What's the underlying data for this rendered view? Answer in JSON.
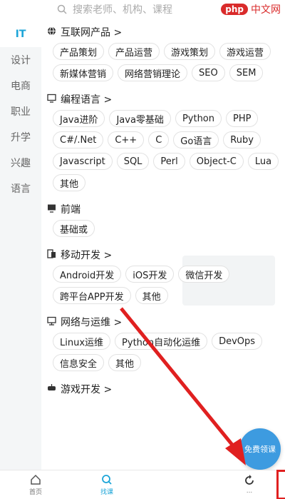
{
  "search": {
    "placeholder": "搜索老师、机构、课程"
  },
  "watermark": {
    "php": "php",
    "text": "中文网"
  },
  "sidebar": {
    "items": [
      {
        "label": "IT",
        "active": true
      },
      {
        "label": "设计"
      },
      {
        "label": "电商"
      },
      {
        "label": "职业"
      },
      {
        "label": "升学"
      },
      {
        "label": "兴趣"
      },
      {
        "label": "语言"
      }
    ]
  },
  "sections": [
    {
      "title": "互联网产品 >",
      "icon": "globe-icon",
      "chips": [
        "产品策划",
        "产品运营",
        "游戏策划",
        "游戏运营",
        "新媒体营销",
        "网络营销理论",
        "SEO",
        "SEM"
      ]
    },
    {
      "title": "编程语言 >",
      "icon": "monitor-code-icon",
      "chips": [
        "Java进阶",
        "Java零基础",
        "Python",
        "PHP",
        "C#/.Net",
        "C++",
        "C",
        "Go语言",
        "Ruby",
        "Javascript",
        "SQL",
        "Perl",
        "Object-C",
        "Lua",
        "其他"
      ]
    },
    {
      "title": "前端",
      "icon": "frontend-icon",
      "chips": [
        "基础或"
      ]
    },
    {
      "title": "移动开发 >",
      "icon": "mobile-dev-icon",
      "chips": [
        "Android开发",
        "iOS开发",
        "微信开发",
        "跨平台APP开发",
        "其他"
      ]
    },
    {
      "title": "网络与运维 >",
      "icon": "network-icon",
      "chips": [
        "Linux运维",
        "Python自动化运维",
        "DevOps",
        "信息安全",
        "其他"
      ]
    },
    {
      "title": "游戏开发 >",
      "icon": "game-dev-icon",
      "chips": []
    }
  ],
  "floating_badge": {
    "label": "免费领课"
  },
  "tabbar": {
    "items": [
      {
        "label": "首页",
        "icon": "home-icon"
      },
      {
        "label": "找课",
        "icon": "search-icon",
        "active": true
      },
      {
        "label": "...",
        "icon": "refresh-icon"
      }
    ]
  },
  "colors": {
    "accent": "#1da5d8",
    "annotation": "#e02020"
  }
}
